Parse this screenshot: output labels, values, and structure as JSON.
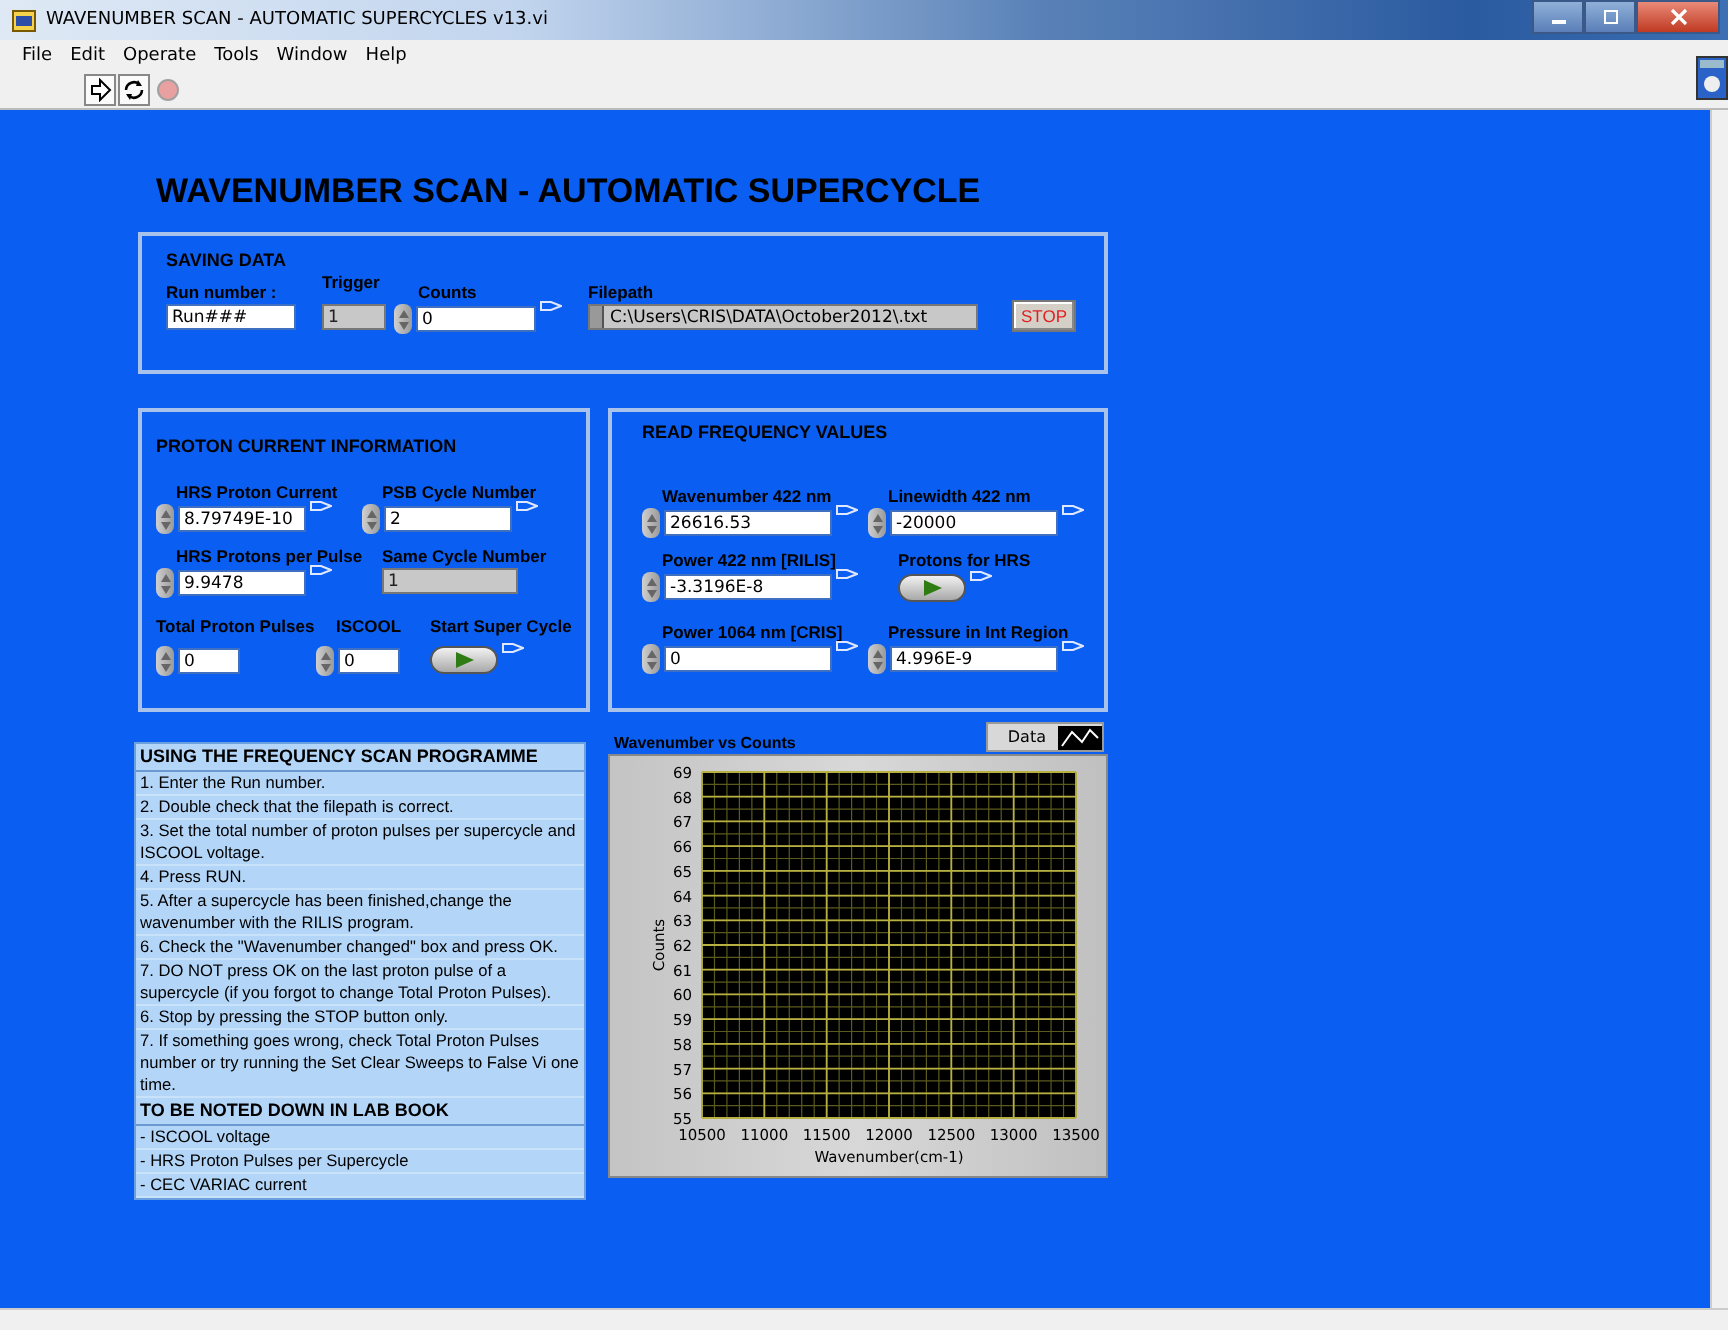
{
  "window": {
    "title": "WAVENUMBER SCAN - AUTOMATIC SUPERCYCLES v13.vi"
  },
  "menu": [
    "File",
    "Edit",
    "Operate",
    "Tools",
    "Window",
    "Help"
  ],
  "toolbar": [
    {
      "kind": "run",
      "disabled": false
    },
    {
      "kind": "run-continuously",
      "disabled": false
    },
    {
      "kind": "abort",
      "disabled": true
    }
  ],
  "panel_title": "WAVENUMBER SCAN - AUTOMATIC SUPERCYCLE",
  "saving_data": {
    "title": "SAVING DATA",
    "controls": [
      {
        "kind": "string",
        "label": "Run number :",
        "value": "Run###",
        "flag": false
      },
      {
        "kind": "indicator",
        "label": "Trigger",
        "value": "1",
        "flag": false
      },
      {
        "kind": "numeric",
        "label": "Counts",
        "value": "0",
        "flag": true
      },
      {
        "kind": "path",
        "label": "Filepath",
        "value": "C:\\Users\\CRIS\\DATA\\October2012\\.txt",
        "flag": false
      },
      {
        "kind": "stop",
        "label": "STOP"
      }
    ]
  },
  "proton_current": {
    "title": "PROTON CURRENT INFORMATION",
    "rows": [
      [
        {
          "kind": "numeric",
          "label": "HRS Proton Current",
          "value": "8.79749E-10",
          "flag": true
        },
        {
          "kind": "numeric",
          "label": "PSB Cycle Number",
          "value": "2",
          "flag": true
        }
      ],
      [
        {
          "kind": "numeric",
          "label": "HRS Protons per Pulse",
          "value": "9.9478",
          "flag": true
        },
        {
          "kind": "indicator",
          "label": "Same Cycle Number",
          "value": "1",
          "flag": false
        }
      ],
      [
        {
          "kind": "numeric",
          "label": "Total Proton Pulses",
          "value": "0",
          "flag": false
        },
        {
          "kind": "numeric",
          "label": "ISCOOL",
          "value": "0",
          "flag": false
        },
        {
          "kind": "switch",
          "label": "Start Super Cycle",
          "on": false,
          "flag": true
        }
      ]
    ]
  },
  "frequency": {
    "title": "READ FREQUENCY VALUES",
    "rows": [
      [
        {
          "kind": "numeric",
          "label": "Wavenumber 422 nm",
          "value": "26616.53",
          "flag": true
        },
        {
          "kind": "numeric",
          "label": "Linewidth 422 nm",
          "value": "-20000",
          "flag": true
        }
      ],
      [
        {
          "kind": "numeric",
          "label": "Power 422 nm [RILIS]",
          "value": "-3.3196E-8",
          "flag": true
        },
        {
          "kind": "switch",
          "label": "Protons for HRS",
          "on": false,
          "flag": true
        }
      ],
      [
        {
          "kind": "numeric",
          "label": "Power 1064 nm [CRIS]",
          "value": "0",
          "flag": true
        },
        {
          "kind": "numeric",
          "label": "Pressure in Int Region",
          "value": "4.996E-9",
          "flag": true
        }
      ]
    ]
  },
  "instructions": [
    {
      "kind": "heading",
      "text": "USING THE FREQUENCY SCAN PROGRAMME"
    },
    {
      "kind": "line",
      "text": "1. Enter the Run number."
    },
    {
      "kind": "line",
      "text": "2. Double check that the filepath is correct."
    },
    {
      "kind": "line",
      "text": "3. Set the total number of proton pulses per supercycle and ISCOOL voltage."
    },
    {
      "kind": "line",
      "text": "4. Press RUN."
    },
    {
      "kind": "line",
      "text": "5. After a supercycle has been finished,change the wavenumber with the RILIS program."
    },
    {
      "kind": "line",
      "text": "6. Check the \"Wavenumber changed\" box and press OK."
    },
    {
      "kind": "line",
      "text": "7. DO NOT press OK on the last proton pulse of a supercycle (if you forgot to change Total Proton Pulses)."
    },
    {
      "kind": "line",
      "text": "6. Stop by pressing the STOP button only."
    },
    {
      "kind": "line",
      "text": "7. If something goes wrong, check Total Proton Pulses number or try running the Set Clear Sweeps to False Vi one time."
    },
    {
      "kind": "heading",
      "text": "TO BE NOTED DOWN IN LAB BOOK"
    },
    {
      "kind": "line",
      "text": "- ISCOOL voltage"
    },
    {
      "kind": "line",
      "text": "- HRS Proton Pulses per Supercycle"
    },
    {
      "kind": "line",
      "text": "- CEC VARIAC current"
    }
  ],
  "graph": {
    "legend": "Data",
    "chart_data": {
      "type": "line",
      "grid": true,
      "title": "Wavenumber vs Counts",
      "xlabel": "Wavenumber(cm-1)",
      "ylabel": "Counts",
      "xlim": [
        10500,
        13500
      ],
      "ylim": [
        55,
        69
      ],
      "xticks": [
        10500,
        11000,
        11500,
        12000,
        12500,
        13000,
        13500
      ],
      "yticks": [
        55,
        56,
        57,
        58,
        59,
        60,
        61,
        62,
        63,
        64,
        65,
        66,
        67,
        68,
        69
      ]
    }
  }
}
